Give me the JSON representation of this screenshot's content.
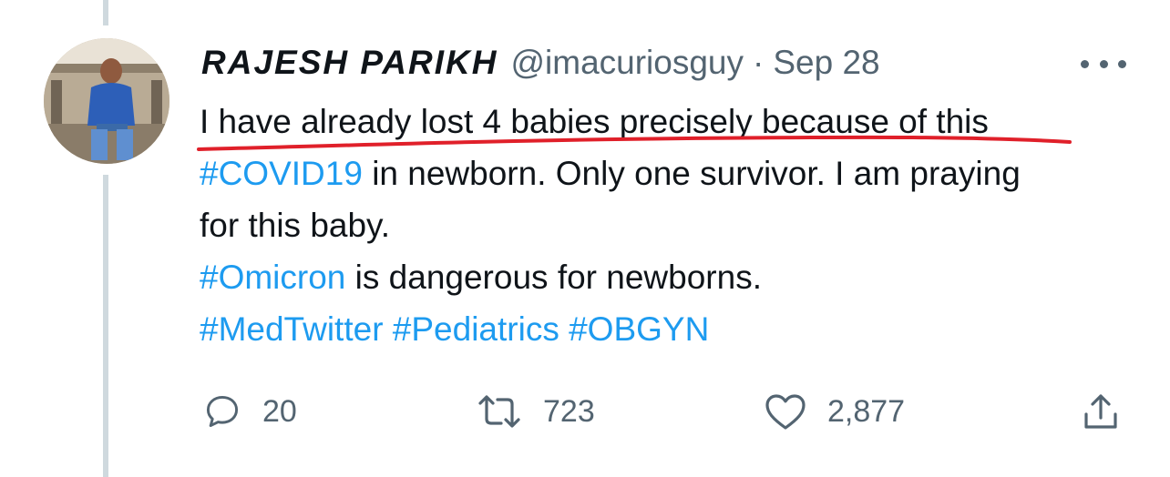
{
  "tweet": {
    "author_name": "RAJESH PARIKH",
    "handle": "@imacuriosguy",
    "separator": "·",
    "date": "Sep 28",
    "lines": [
      [
        {
          "text": "I have already lost 4 babies precisely because of this",
          "tag": false
        }
      ],
      [
        {
          "text": "#COVID19",
          "tag": true
        },
        {
          "text": " in newborn. Only one survivor. I am praying",
          "tag": false
        }
      ],
      [
        {
          "text": "for this baby.",
          "tag": false
        }
      ],
      [
        {
          "text": "#Omicron",
          "tag": true
        },
        {
          "text": " is dangerous for newborns.",
          "tag": false
        }
      ],
      [
        {
          "text": "#MedTwitter",
          "tag": true
        },
        {
          "text": " ",
          "tag": false
        },
        {
          "text": "#Pediatrics",
          "tag": true
        },
        {
          "text": " ",
          "tag": false
        },
        {
          "text": "#OBGYN",
          "tag": true
        }
      ]
    ]
  },
  "actions": {
    "reply_count": "20",
    "retweet_count": "723",
    "like_count": "2,877"
  },
  "icons": {
    "more": "more-dots-icon",
    "reply": "reply-icon",
    "retweet": "retweet-icon",
    "like": "heart-icon",
    "share": "share-icon"
  },
  "colors": {
    "text": "#0f1419",
    "muted": "#536471",
    "hashtag": "#1d9bf0",
    "underline_annotation": "#e0202a",
    "thread_line": "#cfd9de"
  }
}
